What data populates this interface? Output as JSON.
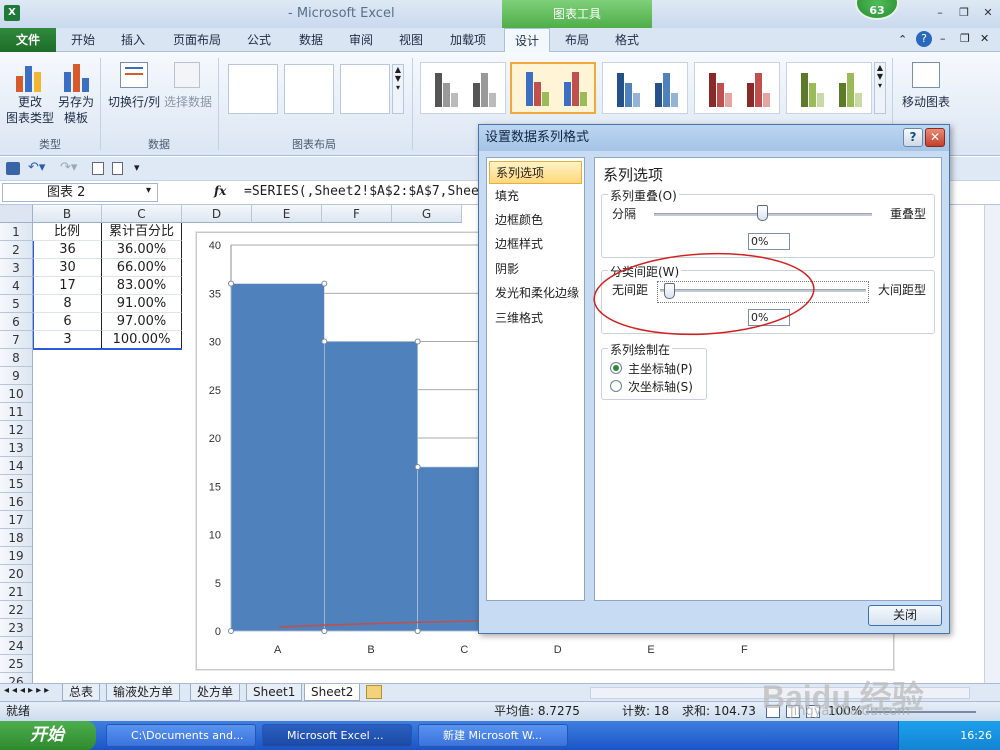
{
  "window": {
    "app_title": "- Microsoft Excel",
    "context_tab_group": "图表工具",
    "notification_count": "63",
    "app_icon_letter": "X"
  },
  "ribbon_tabs": [
    "文件",
    "开始",
    "插入",
    "页面布局",
    "公式",
    "数据",
    "审阅",
    "视图",
    "加载项",
    "设计",
    "布局",
    "格式"
  ],
  "ribbon": {
    "type_group": {
      "label": "类型",
      "change_btn": "更改\n图表类型",
      "save_template_btn": "另存为\n模板"
    },
    "data_group": {
      "label": "数据",
      "switch_btn": "切换行/列",
      "select_btn": "选择数据"
    },
    "layout_group": {
      "label": "图表布局"
    },
    "move_btn": "移动图表"
  },
  "formula_bar": {
    "name_box": "图表 2",
    "fx": "fx",
    "formula": "=SERIES(,Sheet2!$A$2:$A$7,Sheet"
  },
  "columns": [
    "B",
    "C",
    "D",
    "E",
    "F",
    "G"
  ],
  "headers": {
    "b": "比例",
    "c": "累计百分比"
  },
  "rows": [
    {
      "b": "36",
      "c": "36.00%"
    },
    {
      "b": "30",
      "c": "66.00%"
    },
    {
      "b": "17",
      "c": "83.00%"
    },
    {
      "b": "8",
      "c": "91.00%"
    },
    {
      "b": "6",
      "c": "97.00%"
    },
    {
      "b": "3",
      "c": "100.00%"
    }
  ],
  "row_numbers": [
    "1",
    "2",
    "3",
    "4",
    "5",
    "6",
    "7",
    "8",
    "9",
    "10",
    "11",
    "12",
    "13",
    "14",
    "15",
    "16",
    "17",
    "18",
    "19",
    "20",
    "21",
    "22",
    "23",
    "24",
    "25",
    "26"
  ],
  "chart_data": {
    "type": "bar",
    "categories": [
      "A",
      "B",
      "C",
      "D",
      "E",
      "F"
    ],
    "values": [
      36,
      30,
      17,
      8,
      6,
      3
    ],
    "gap_width_percent": 0,
    "ylim": [
      0,
      40
    ],
    "yticks": [
      0,
      5,
      10,
      15,
      20,
      25,
      30,
      35,
      40
    ],
    "bar_color": "#4f81bd",
    "line_color": "#c0504d",
    "grid": true,
    "title": "",
    "xlabel": "",
    "ylabel": ""
  },
  "dialog": {
    "title": "设置数据系列格式",
    "help": "?",
    "close_x": "✕",
    "nav": [
      "系列选项",
      "填充",
      "边框颜色",
      "边框样式",
      "阴影",
      "发光和柔化边缘",
      "三维格式"
    ],
    "panel_title": "系列选项",
    "overlap": {
      "label": "系列重叠(O)",
      "left": "分隔",
      "right": "重叠型",
      "value": "0%"
    },
    "gap": {
      "label": "分类间距(W)",
      "left": "无间距",
      "right": "大间距型",
      "value": "0%"
    },
    "plot_on": {
      "label": "系列绘制在",
      "primary": "主坐标轴(P)",
      "secondary": "次坐标轴(S)"
    },
    "close_btn": "关闭"
  },
  "sheet_tabs": [
    "总表",
    "输液处方单",
    "处方单",
    "Sheet1",
    "Sheet2"
  ],
  "status": {
    "ready": "就绪",
    "average": "平均值: 8.7275",
    "count": "计数: 18",
    "sum": "求和: 104.73",
    "zoom": "100%"
  },
  "taskbar": {
    "start": "开始",
    "items": [
      "C:\\Documents and...",
      "Microsoft Excel ...",
      "新建 Microsoft W..."
    ],
    "time": "16:26"
  },
  "watermark": {
    "brand": "Baidu 经验",
    "url": "jingyan.baidu.com"
  }
}
